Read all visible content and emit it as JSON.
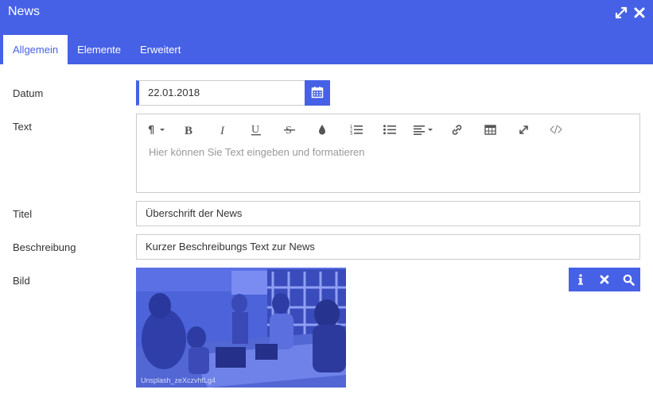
{
  "window": {
    "title": "News",
    "icons": {
      "expand": "expand-icon",
      "close": "close-icon"
    }
  },
  "tabs": [
    {
      "label": "Allgemein",
      "active": true
    },
    {
      "label": "Elemente",
      "active": false
    },
    {
      "label": "Erweitert",
      "active": false
    }
  ],
  "form": {
    "date": {
      "label": "Datum",
      "value": "22.01.2018",
      "icon": "calendar-icon"
    },
    "text": {
      "label": "Text",
      "placeholder": "Hier können Sie Text eingeben und formatieren",
      "toolbar": [
        "paragraph-format-icon",
        "bold-icon",
        "italic-icon",
        "underline-icon",
        "strikethrough-icon",
        "color-icon",
        "ordered-list-icon",
        "unordered-list-icon",
        "align-icon",
        "link-icon",
        "table-icon",
        "fullscreen-icon",
        "code-view-icon"
      ]
    },
    "title": {
      "label": "Titel",
      "value": "Überschrift der News"
    },
    "description": {
      "label": "Beschreibung",
      "value": "Kurzer Beschreibungs Text zur News"
    },
    "image": {
      "label": "Bild",
      "caption": "Unsplash_zeXczvhfLg4",
      "actions": [
        "info-icon",
        "remove-icon",
        "zoom-icon"
      ]
    }
  },
  "colors": {
    "accent": "#4661e6",
    "border": "#cccccc",
    "text": "#333333",
    "placeholder": "#999999"
  }
}
